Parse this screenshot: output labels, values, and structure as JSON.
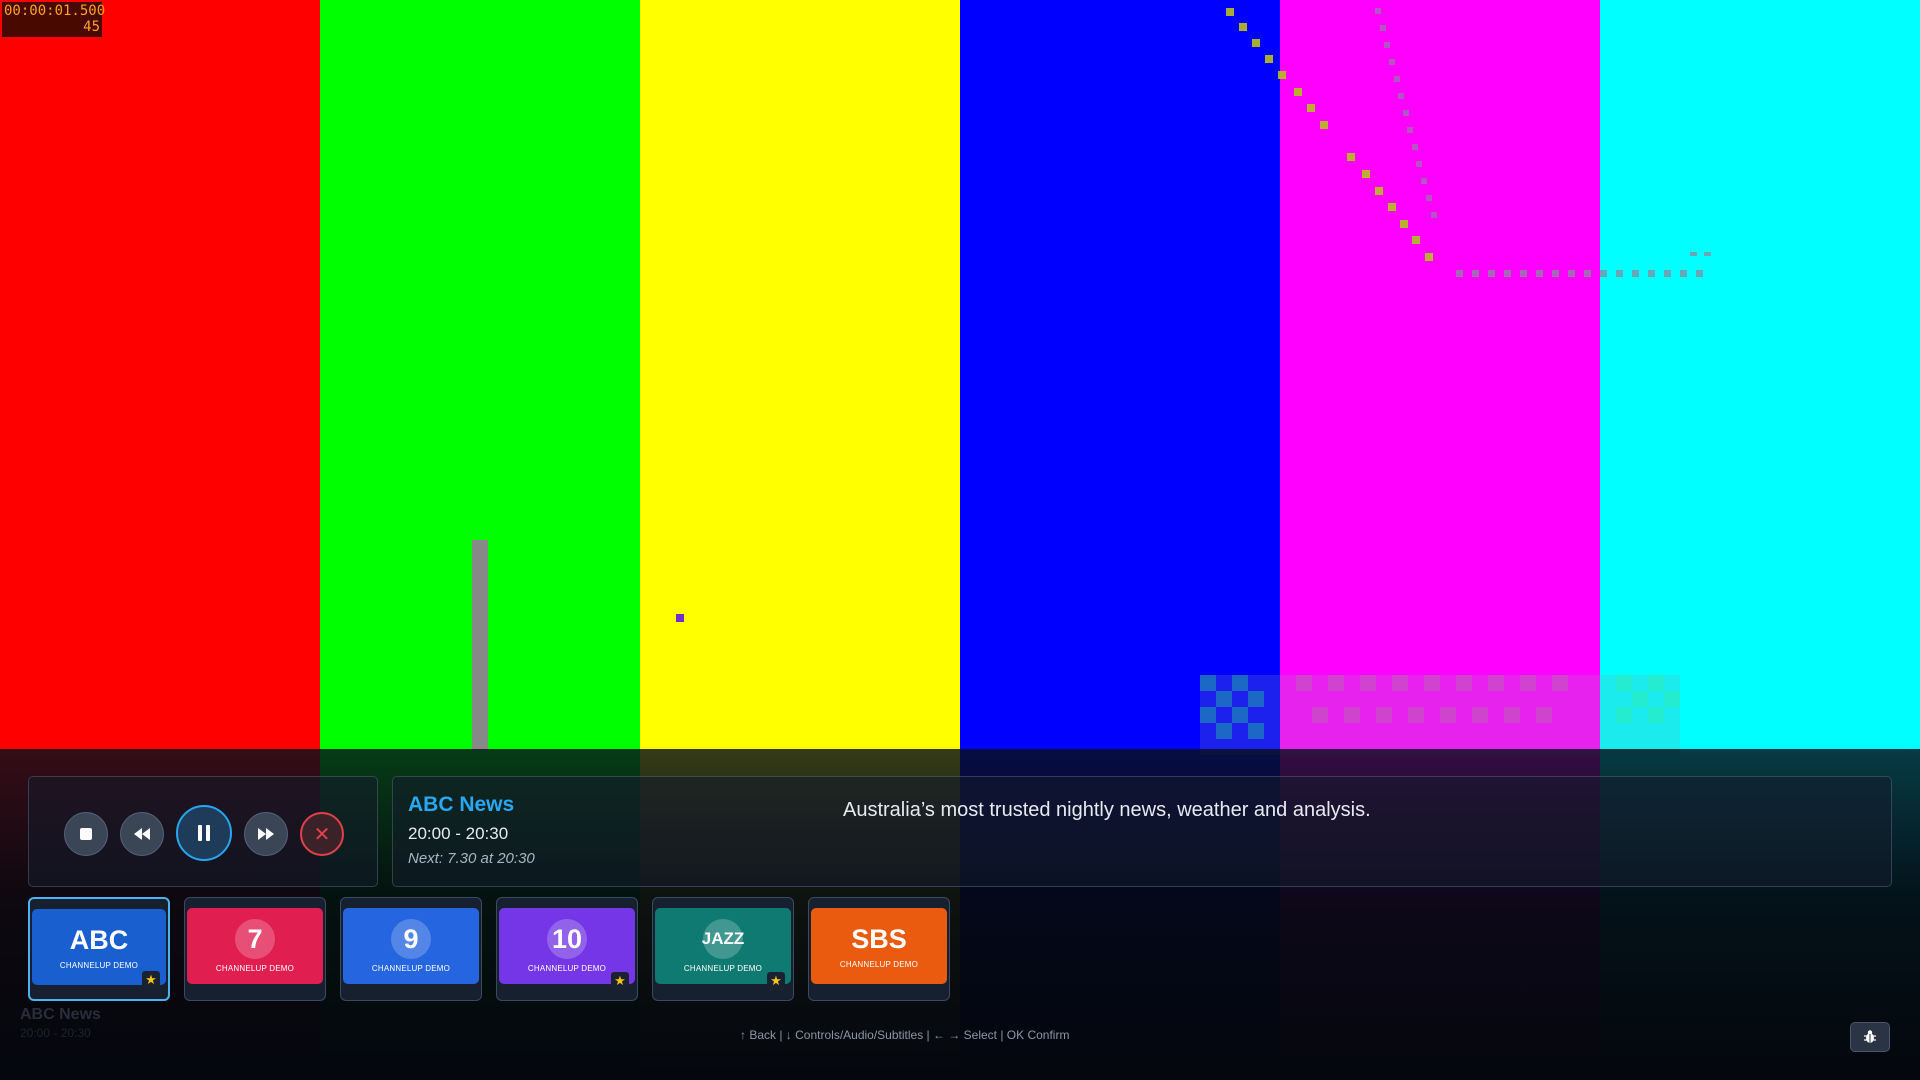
{
  "timecode": {
    "time": "00:00:01.500",
    "frame": "45"
  },
  "test_pattern": {
    "colors": [
      "#ff0000",
      "#00ff00",
      "#ffff00",
      "#0000ff",
      "#ff00ff",
      "#00ffff"
    ]
  },
  "controls": {
    "stop": "stop-icon",
    "rewind": "rewind-icon",
    "pause": "pause-icon",
    "forward": "fast-forward-icon",
    "close": "✕"
  },
  "program": {
    "title": "ABC News",
    "time": "20:00 - 20:30",
    "next": "Next: 7.30 at 20:30",
    "description": "Australia’s most trusted nightly news, weather and analysis."
  },
  "channels": [
    {
      "name": "ABC",
      "sub": "CHANNELUP DEMO",
      "color": "#1a5fd0",
      "favorite": true,
      "selected": true
    },
    {
      "name": "7",
      "sub": "CHANNELUP DEMO",
      "color": "#e01e50",
      "favorite": false,
      "selected": false
    },
    {
      "name": "9",
      "sub": "CHANNELUP DEMO",
      "color": "#2565e0",
      "favorite": false,
      "selected": false
    },
    {
      "name": "10",
      "sub": "CHANNELUP DEMO",
      "color": "#7436e6",
      "favorite": true,
      "selected": false
    },
    {
      "name": "JAZZ",
      "sub": "CHANNELUP DEMO",
      "color": "#0f7a72",
      "favorite": true,
      "selected": false
    },
    {
      "name": "SBS",
      "sub": "CHANNELUP DEMO",
      "color": "#ea5a0f",
      "favorite": false,
      "selected": false
    }
  ],
  "footer_hint": "↑ Back | ↓ Controls/Audio/Subtitles | ← → Select | OK Confirm",
  "ghost_label": {
    "title": "ABC News",
    "time": "20:00 - 20:30"
  },
  "debug_icon": "bug-icon"
}
